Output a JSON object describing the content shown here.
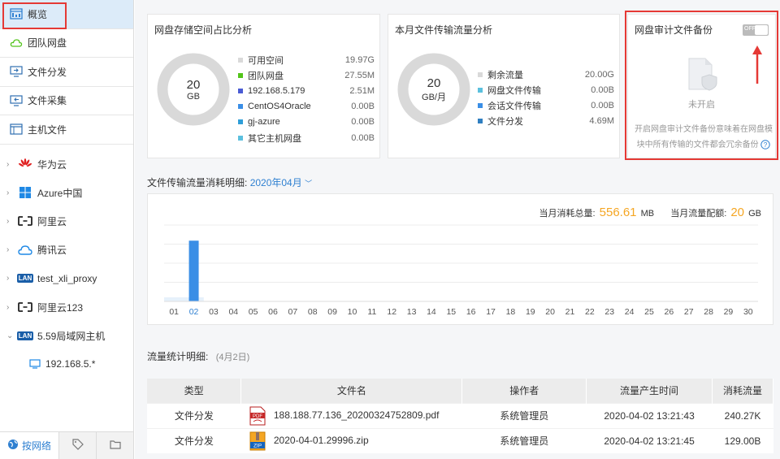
{
  "sidebar": {
    "nav": [
      {
        "label": "概览",
        "icon": "dashboard-icon"
      },
      {
        "label": "团队网盘",
        "icon": "cloud-drive-icon"
      },
      {
        "label": "文件分发",
        "icon": "distribute-icon"
      },
      {
        "label": "文件采集",
        "icon": "collect-icon"
      },
      {
        "label": "主机文件",
        "icon": "host-file-icon"
      }
    ],
    "clouds": [
      {
        "label": "华为云",
        "icon": "huawei-logo-icon"
      },
      {
        "label": "Azure中国",
        "icon": "windows-logo-icon"
      },
      {
        "label": "阿里云",
        "icon": "aliyun-logo-icon"
      },
      {
        "label": "腾讯云",
        "icon": "tencent-cloud-icon"
      },
      {
        "label": "test_xli_proxy",
        "icon": "lan-badge-icon",
        "badge": "LAN"
      },
      {
        "label": "阿里云123",
        "icon": "aliyun-logo-icon"
      },
      {
        "label": "5.59局域网主机",
        "icon": "lan-badge-icon",
        "badge": "LAN"
      }
    ],
    "sub_item": {
      "label": "192.168.5.*",
      "icon": "monitor-icon"
    },
    "bottom_tabs": [
      {
        "label": "按网络",
        "icon": "globe-icon"
      },
      {
        "label": "",
        "icon": "tag-icon"
      },
      {
        "label": "",
        "icon": "folder-icon"
      }
    ]
  },
  "storage": {
    "title": "网盘存储空间占比分析",
    "center_value": "20",
    "center_unit": "GB",
    "legend": [
      {
        "name": "可用空间",
        "value": "19.97G",
        "color": "#d9d9d9"
      },
      {
        "name": "团队网盘",
        "value": "27.55M",
        "color": "#52c41a"
      },
      {
        "name": "192.168.5.179",
        "value": "2.51M",
        "color": "#4a5bd4"
      },
      {
        "name": "CentOS4Oracle",
        "value": "0.00B",
        "color": "#3a8ee6"
      },
      {
        "name": "gj-azure",
        "value": "0.00B",
        "color": "#2f9ed8"
      },
      {
        "name": "其它主机网盘",
        "value": "0.00B",
        "color": "#5bc0de"
      }
    ]
  },
  "traffic": {
    "title": "本月文件传输流量分析",
    "center_value": "20",
    "center_unit": "GB/月",
    "legend": [
      {
        "name": "剩余流量",
        "value": "20.00G",
        "color": "#d9d9d9"
      },
      {
        "name": "网盘文件传输",
        "value": "0.00B",
        "color": "#5bc0de"
      },
      {
        "name": "会话文件传输",
        "value": "0.00B",
        "color": "#3a8ee6"
      },
      {
        "name": "文件分发",
        "value": "4.69M",
        "color": "#2f7fc1"
      }
    ]
  },
  "backup": {
    "title": "网盘审计文件备份",
    "toggle_label": "OFF",
    "status": "未开启",
    "description_line1": "开启网盘审计文件备份意味着在网盘模",
    "description_line2": "块中所有传输的文件都会冗余备份",
    "help_icon": "question-circle-icon"
  },
  "usage": {
    "title": "文件传输流量消耗明细:",
    "month": "2020年04月",
    "total_label": "当月消耗总量:",
    "total_value": "556.61",
    "total_unit": "MB",
    "quota_label": "当月流量配额:",
    "quota_value": "20",
    "quota_unit": "GB"
  },
  "chart_data": {
    "type": "bar",
    "categories": [
      "01",
      "02",
      "03",
      "04",
      "05",
      "06",
      "07",
      "08",
      "09",
      "10",
      "11",
      "12",
      "13",
      "14",
      "15",
      "16",
      "17",
      "18",
      "19",
      "20",
      "21",
      "22",
      "23",
      "24",
      "25",
      "26",
      "27",
      "28",
      "29",
      "30"
    ],
    "series": [
      {
        "values": [
          0,
          556.61,
          0,
          0,
          0,
          0,
          0,
          0,
          0,
          0,
          0,
          0,
          0,
          0,
          0,
          0,
          0,
          0,
          0,
          0,
          0,
          0,
          0,
          0,
          0,
          0,
          0,
          0,
          0,
          0
        ]
      }
    ],
    "selected_category": "02",
    "ylim": [
      0,
      700
    ],
    "grid": true,
    "colors": {
      "bar": "#3a8ee6",
      "highlight": "#e6f1fb"
    }
  },
  "stats": {
    "title": "流量统计明细:",
    "date": "(4月2日)",
    "columns": [
      "类型",
      "文件名",
      "操作者",
      "流量产生时间",
      "消耗流量"
    ],
    "rows": [
      {
        "type": "文件分发",
        "file": "188.188.77.136_20200324752809.pdf",
        "file_icon": "pdf-file-icon",
        "operator": "系统管理员",
        "time": "2020-04-02 13:21:43",
        "traffic": "240.27K"
      },
      {
        "type": "文件分发",
        "file": "2020-04-01.29996.zip",
        "file_icon": "zip-file-icon",
        "operator": "系统管理员",
        "time": "2020-04-02 13:21:45",
        "traffic": "129.00B"
      }
    ]
  },
  "colors": {
    "accent": "#2f80d1",
    "orange": "#f5a623",
    "red": "#e53935"
  }
}
